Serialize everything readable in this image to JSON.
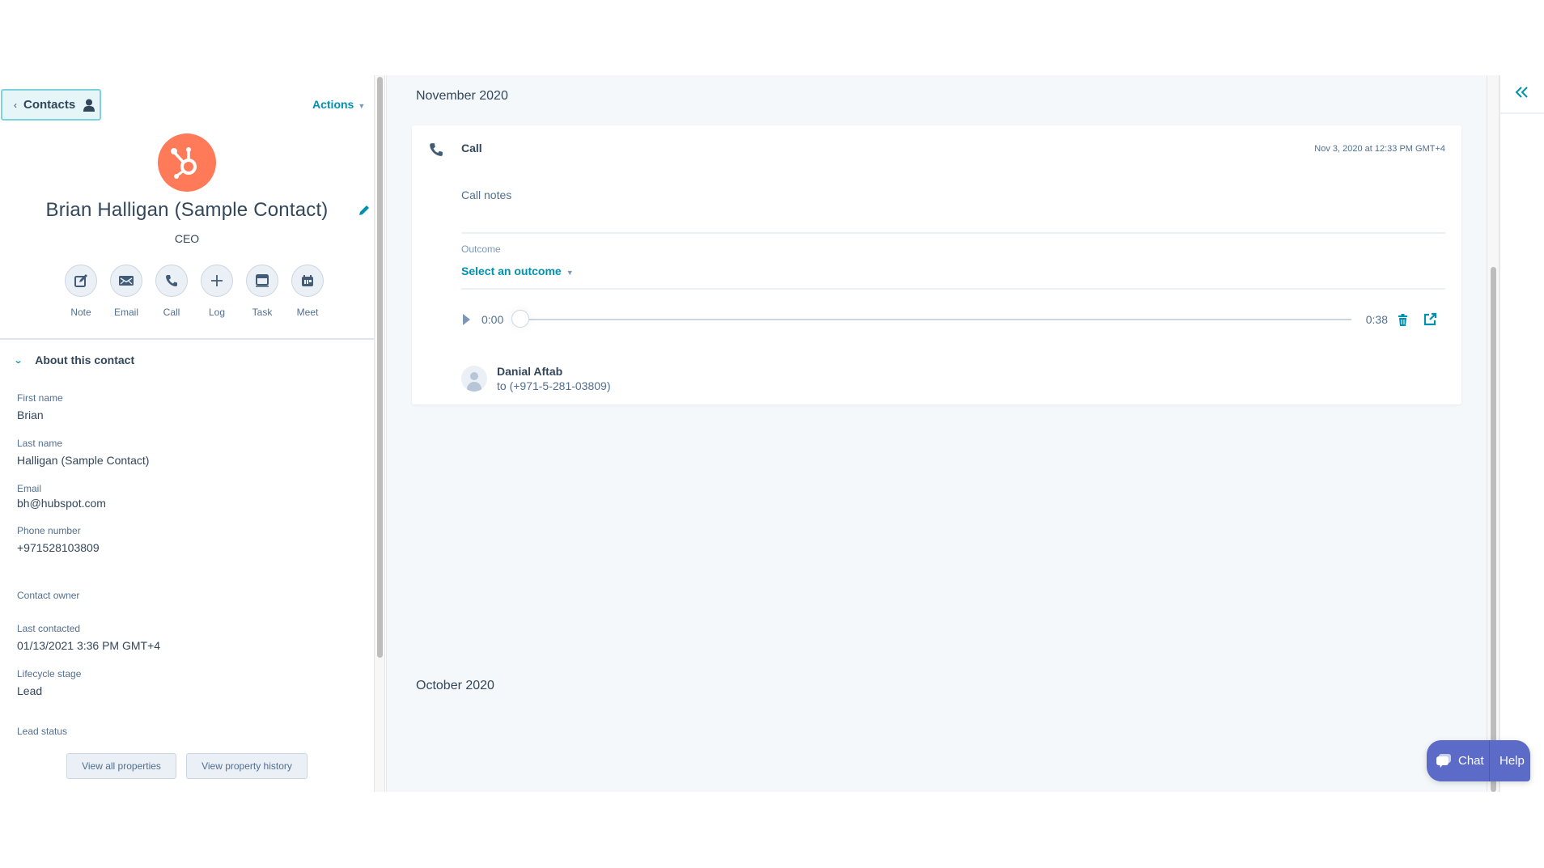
{
  "left_panel": {
    "back_button": {
      "label": "Contacts",
      "chevron": "chevron-left-icon",
      "icon": "person-icon"
    },
    "actions_label": "Actions",
    "contact": {
      "name": "Brian Halligan (Sample Contact)",
      "title": "CEO",
      "logo": "hubspot-sprocket-logo",
      "logo_color": "#ff7a59"
    },
    "quick_actions": [
      {
        "label": "Note",
        "icon": "note-edit-icon"
      },
      {
        "label": "Email",
        "icon": "envelope-icon"
      },
      {
        "label": "Call",
        "icon": "phone-icon"
      },
      {
        "label": "Log",
        "icon": "plus-icon"
      },
      {
        "label": "Task",
        "icon": "task-icon"
      },
      {
        "label": "Meet",
        "icon": "calendar-icon"
      }
    ],
    "about_section": {
      "title": "About this contact",
      "properties": [
        {
          "label": "First name",
          "value": "Brian"
        },
        {
          "label": "Last name",
          "value": "Halligan (Sample Contact)"
        },
        {
          "label": "Email",
          "value": "bh@hubspot.com"
        },
        {
          "label": "Phone number",
          "value": "+971528103809"
        },
        {
          "label": "Contact owner",
          "value": ""
        },
        {
          "label": "Last contacted",
          "value": "01/13/2021 3:36 PM GMT+4"
        },
        {
          "label": "Lifecycle stage",
          "value": "Lead"
        },
        {
          "label": "Lead status",
          "value": ""
        }
      ],
      "view_all_label": "View all properties",
      "view_history_label": "View property history"
    }
  },
  "timeline": {
    "groups": [
      {
        "month": "November 2020",
        "activities": [
          {
            "type": "Call",
            "timestamp": "Nov 3, 2020 at 12:33 PM GMT+4",
            "notes": "Call notes",
            "outcome_label": "Outcome",
            "outcome_value": "Select an outcome",
            "recording": {
              "current": "0:00",
              "duration": "0:38",
              "progress": 0
            },
            "caller_name": "Danial Aftab",
            "caller_to": "to (+971-5-281-03809)"
          }
        ]
      },
      {
        "month": "October 2020",
        "activities": []
      }
    ]
  },
  "right_panel": {
    "collapse_icon": "double-chevron-left-icon"
  },
  "chat_widget": {
    "chat_label": "Chat",
    "help_label": "Help",
    "color": "#5c6bc8"
  },
  "colors": {
    "accent": "#0091ae",
    "text": "#33475b",
    "muted": "#516f90",
    "bg": "#f5f8fa"
  }
}
